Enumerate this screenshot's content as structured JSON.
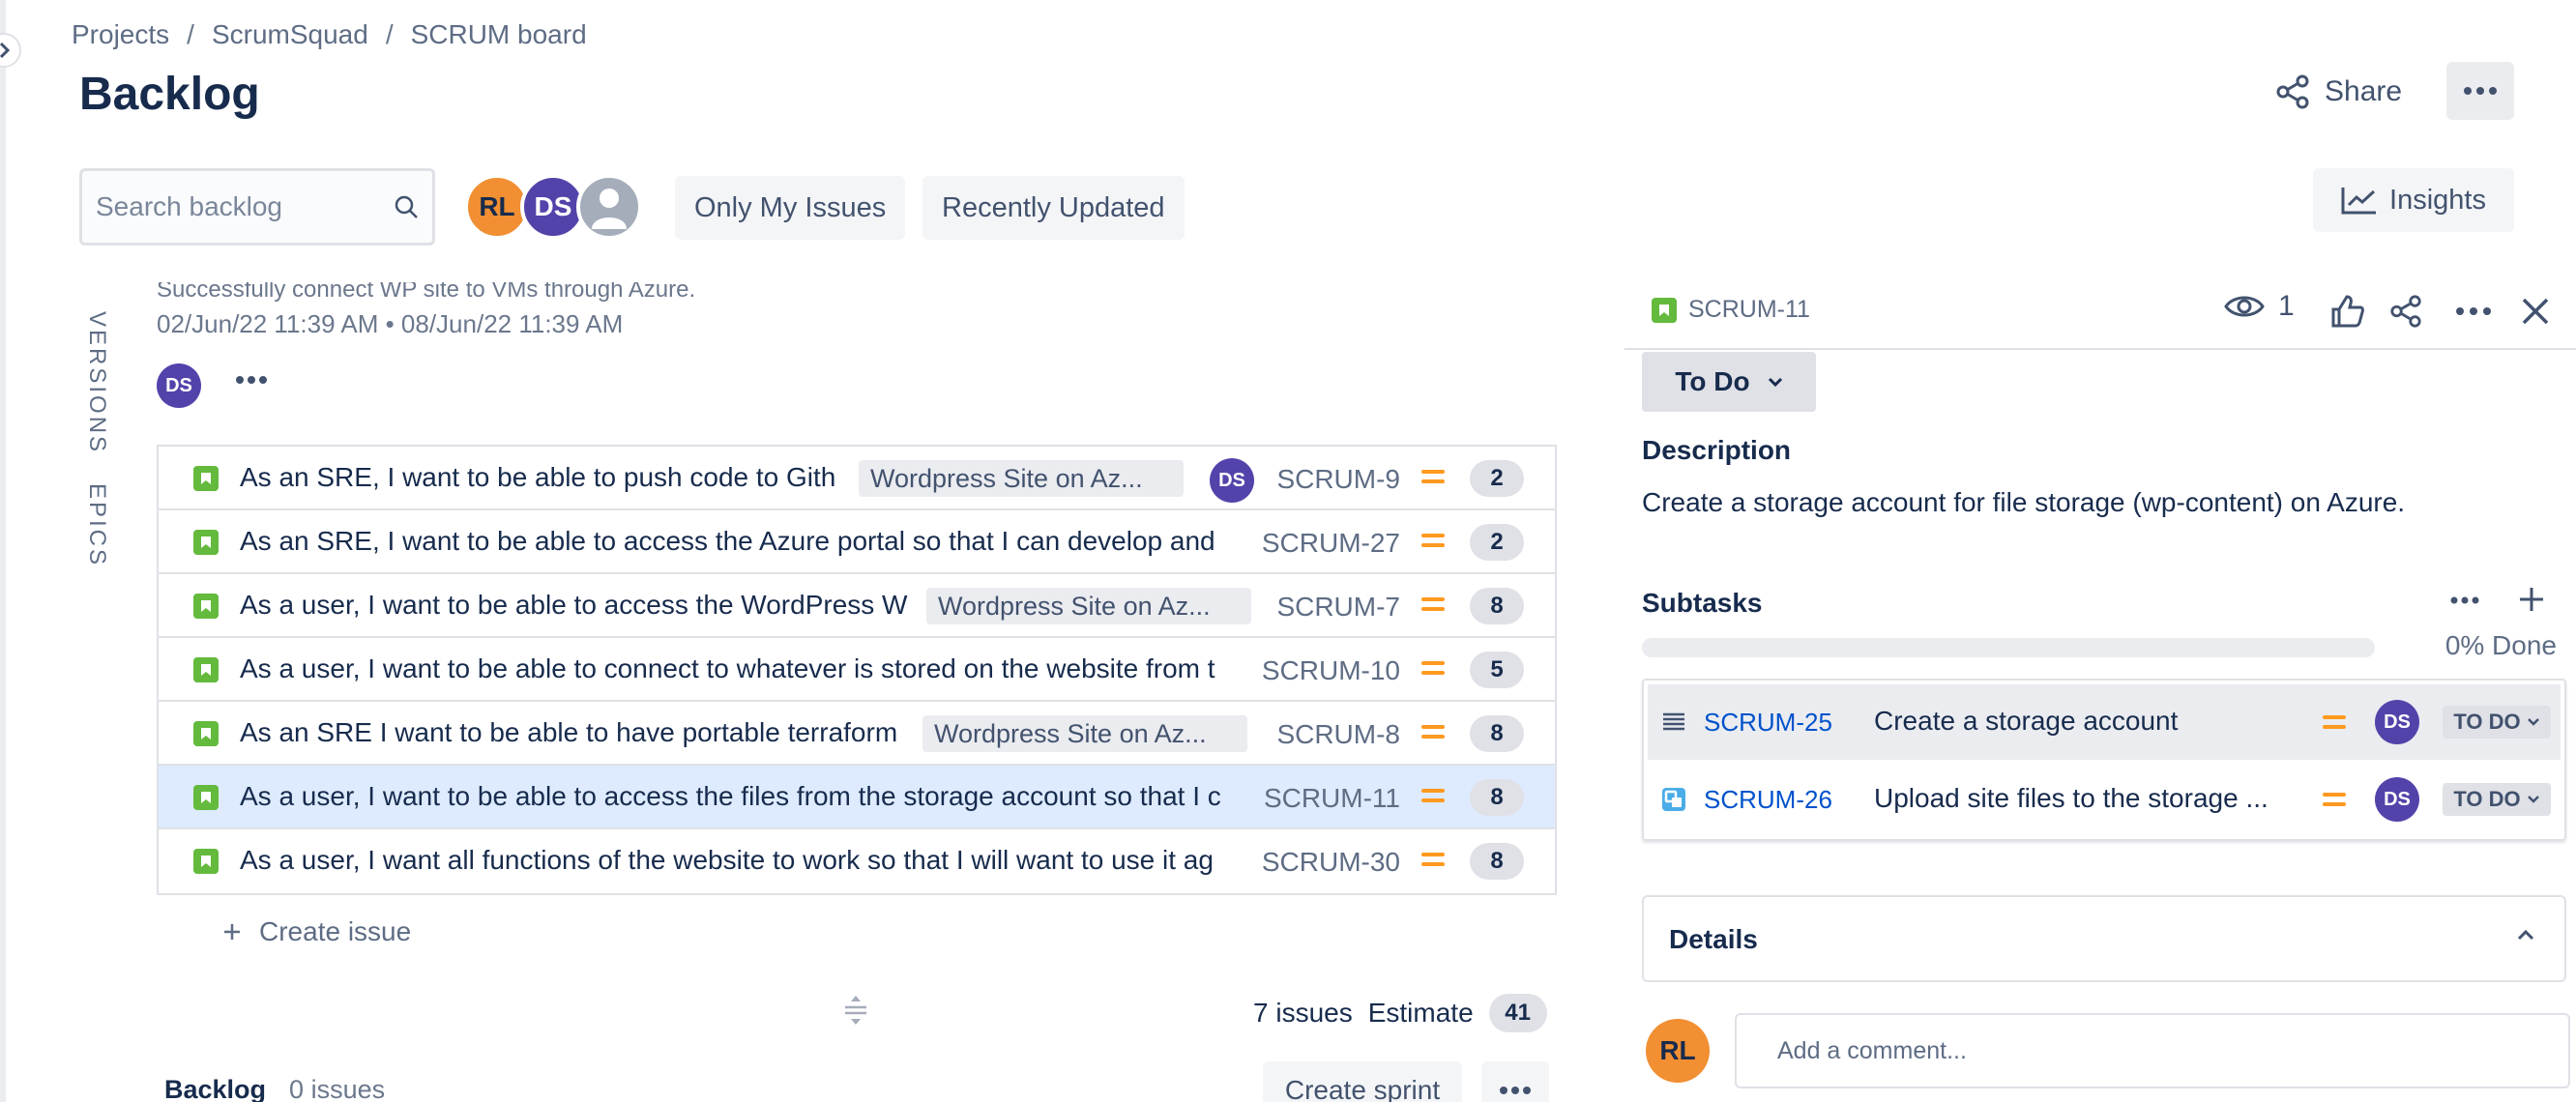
{
  "breadcrumb": [
    "Projects",
    "ScrumSquad",
    "SCRUM board"
  ],
  "breadcrumb_sep": "/",
  "page_title": "Backlog",
  "header": {
    "share_label": "Share"
  },
  "search": {
    "placeholder": "Search backlog"
  },
  "avatars": [
    "RL",
    "DS"
  ],
  "filters": {
    "only_my_issues": "Only My Issues",
    "recently_updated": "Recently Updated"
  },
  "insights_label": "Insights",
  "side_tabs": {
    "versions": "VERSIONS",
    "epics": "EPICS"
  },
  "sprint": {
    "goal": "Successfully connect WP site to VMs through Azure.",
    "dates": "02/Jun/22 11:39 AM  •  08/Jun/22 11:39 AM",
    "assignee": "DS"
  },
  "issues": [
    {
      "summary": "As an SRE, I want to be able to push code to Gith",
      "epic": "Wordpress Site on Az...",
      "assignee": "DS",
      "key": "SCRUM-9",
      "points": "2"
    },
    {
      "summary": "As an SRE, I want to be able to access the Azure portal so that I can develop and",
      "epic": "",
      "assignee": "",
      "key": "SCRUM-27",
      "points": "2"
    },
    {
      "summary": "As a user, I want to be able to access the WordPress W",
      "epic": "Wordpress Site on Az...",
      "assignee": "",
      "key": "SCRUM-7",
      "points": "8"
    },
    {
      "summary": "As a user, I want to be able to connect to whatever is stored on the website from t",
      "epic": "",
      "assignee": "",
      "key": "SCRUM-10",
      "points": "5"
    },
    {
      "summary": "As an SRE I want to be able to have portable terraform",
      "epic": "Wordpress Site on Az...",
      "assignee": "",
      "key": "SCRUM-8",
      "points": "8"
    },
    {
      "summary": "As a user, I want to be able to access the files from the storage account so that I c",
      "epic": "",
      "assignee": "",
      "key": "SCRUM-11",
      "points": "8"
    },
    {
      "summary": "As a user, I want all functions of the website to work so that I will want to use it ag",
      "epic": "",
      "assignee": "",
      "key": "SCRUM-30",
      "points": "8"
    }
  ],
  "create_issue_label": "Create issue",
  "sprint_summary": {
    "issues": "7 issues",
    "estimate_label": "Estimate",
    "estimate_value": "41"
  },
  "backlog": {
    "title": "Backlog",
    "count": "0 issues",
    "create_sprint": "Create sprint"
  },
  "detail": {
    "key": "SCRUM-11",
    "watchers": "1",
    "status": "To Do",
    "description_title": "Description",
    "description": "Create a storage account for file storage (wp-content) on Azure.",
    "subtasks_title": "Subtasks",
    "progress_label": "0% Done",
    "progress_fraction": 0,
    "subtasks": [
      {
        "key": "SCRUM-25",
        "summary": "Create a storage account",
        "assignee": "DS",
        "status": "TO DO"
      },
      {
        "key": "SCRUM-26",
        "summary": "Upload site files to the storage ...",
        "assignee": "DS",
        "status": "TO DO"
      }
    ],
    "details_title": "Details",
    "comment_avatar": "RL",
    "comment_placeholder": "Add a comment..."
  },
  "colors": {
    "story": "#63ba3c",
    "priority": "#ff991f",
    "assignee_ds": "#5243aa",
    "assignee_rl": "#f18f32",
    "selected_row": "#deebff",
    "link": "#0052cc"
  }
}
